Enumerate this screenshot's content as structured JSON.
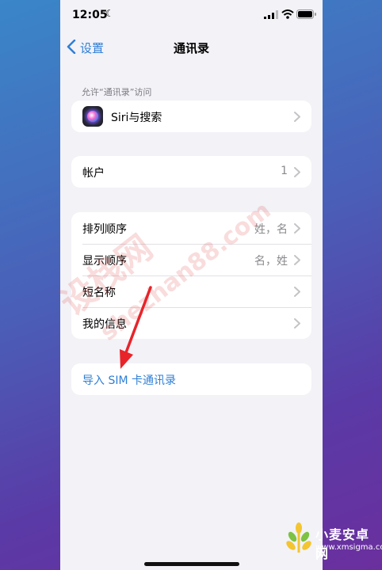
{
  "status_bar": {
    "time": "12:05",
    "moon": "☾"
  },
  "nav": {
    "back_label": "设置",
    "title": "通讯录"
  },
  "section_header": "允许“通讯录”访问",
  "siri_row": {
    "label": "Siri与搜索"
  },
  "accounts_row": {
    "label": "帐户",
    "value": "1"
  },
  "settings_rows": [
    {
      "label": "排列顺序",
      "value": "姓，名"
    },
    {
      "label": "显示顺序",
      "value": "名，姓"
    },
    {
      "label": "短名称",
      "value": ""
    },
    {
      "label": "我的信息",
      "value": ""
    }
  ],
  "import_row": {
    "label": "导入 SIM 卡通讯录"
  },
  "watermark": {
    "line1": "设栈网",
    "line2": "shezhan88.com"
  },
  "site_logo": {
    "name": "小麦安卓网",
    "url": "www.xmsigma.com"
  },
  "colors": {
    "accent": "#2f7fd6",
    "arrow": "#e8242a"
  }
}
